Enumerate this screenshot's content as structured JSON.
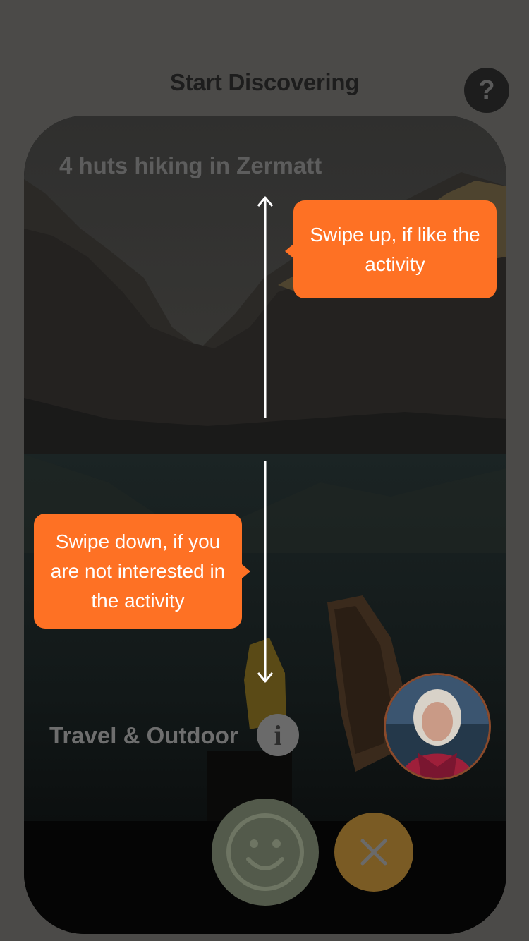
{
  "header": {
    "title": "Start Discovering",
    "help_label": "?"
  },
  "card": {
    "title": "4 huts hiking in Zermatt",
    "category": "Travel & Outdoor",
    "info_label": "i"
  },
  "tooltips": {
    "swipe_up": "Swipe up, if like the activity",
    "swipe_down": "Swipe down, if you are not interested in the activity"
  },
  "actions": {
    "like_icon": "smiley-icon",
    "dismiss_icon": "close-icon"
  },
  "colors": {
    "accent": "#fe7124",
    "background": "#4b4a48"
  }
}
